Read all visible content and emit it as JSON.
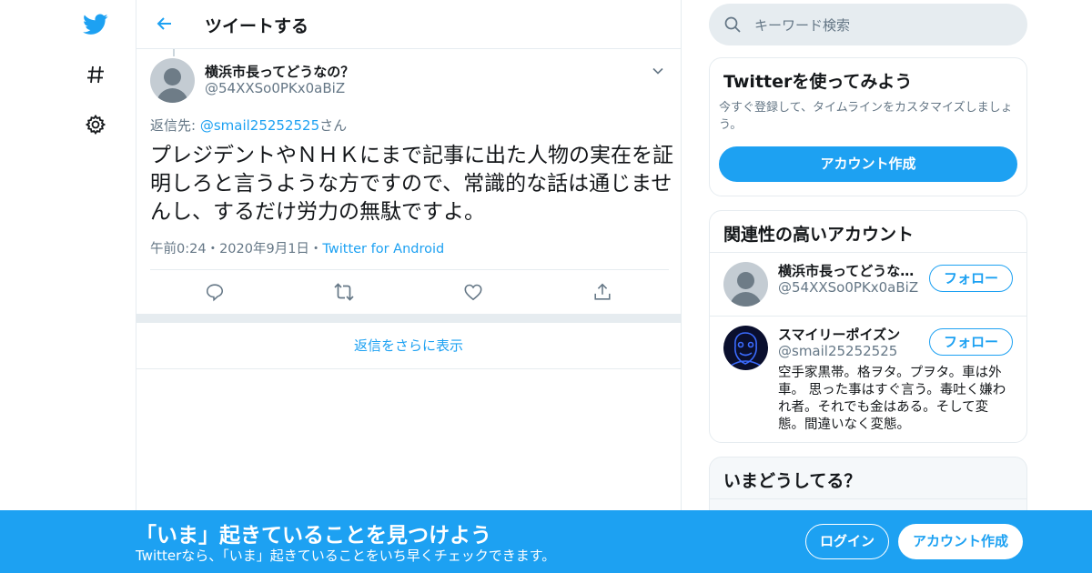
{
  "nav": {
    "icons": [
      "twitter-bird-icon",
      "hashtag-icon",
      "gear-icon"
    ]
  },
  "header": {
    "title": "ツイートする"
  },
  "tweet": {
    "author_name": "横浜市長ってどうなの？",
    "author_handle": "@54XXSo0PKx0aBiZ",
    "reply_prefix": "返信先: ",
    "reply_to": "@smail25252525",
    "reply_suffix": "さん",
    "text": "プレジデントやＮＨＫにまで記事に出た人物の実在を証明しろと言うような方ですので、常識的な話は通じませんし、するだけ労力の無駄ですよ。",
    "time": "午前0:24",
    "date": "2020年9月1日",
    "source": "Twitter for Android",
    "meta_sep": "・"
  },
  "more_replies": "返信をさらに表示",
  "search": {
    "placeholder": "キーワード検索"
  },
  "signup_card": {
    "title": "Twitterを使ってみよう",
    "desc": "今すぐ登録して、タイムラインをカスタマイズしましょう。",
    "button": "アカウント作成"
  },
  "related": {
    "title": "関連性の高いアカウント",
    "accounts": [
      {
        "name": "横浜市長ってどうな…",
        "handle": "@54XXSo0PKx0aBiZ",
        "follow": "フォロー",
        "bio": ""
      },
      {
        "name": "スマイリーポイズン",
        "handle": "@smail25252525",
        "follow": "フォロー",
        "bio": "空手家黒帯。格ヲタ。プヲタ。車は外車。 思った事はすぐ言う。毒吐く嫌われ者。それでも金はある。そして変態。間違いなく変態。"
      }
    ]
  },
  "trends": {
    "title": "いまどうしてる？"
  },
  "banner": {
    "headline": "「いま」起きていることを見つけよう",
    "sub": "Twitterなら、「いま」起きていることをいち早くチェックできます。",
    "login": "ログイン",
    "signup": "アカウント作成"
  },
  "colors": {
    "accent": "#1da1f2",
    "border": "#e6ecf0",
    "muted": "#657786"
  }
}
